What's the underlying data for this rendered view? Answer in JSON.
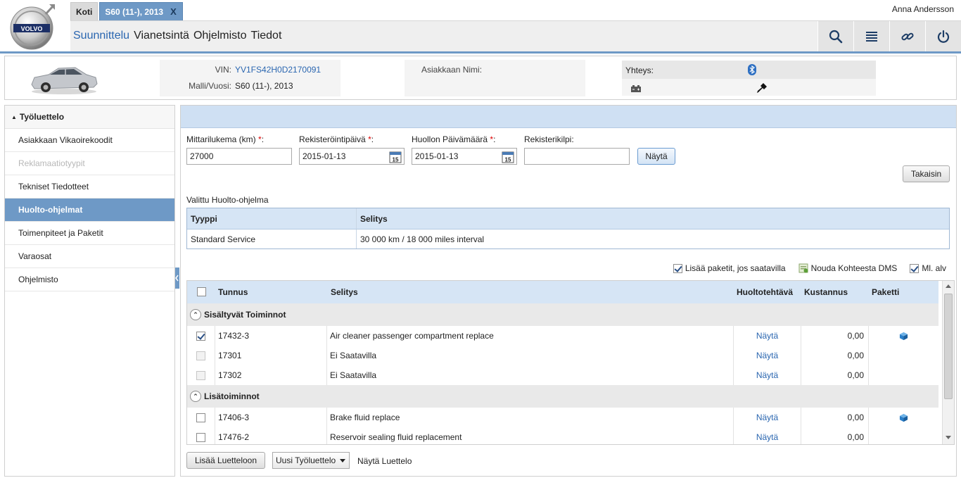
{
  "header": {
    "logo_text": "VOLVO",
    "tabs": [
      {
        "label": "Koti"
      },
      {
        "label": "S60 (11-), 2013",
        "close": "X"
      }
    ],
    "user": "Anna Andersson",
    "menu": [
      "Suunnittelu",
      "Vianetsintä",
      "Ohjelmisto",
      "Tiedot"
    ],
    "tool_icons": [
      "search-icon",
      "list-icon",
      "link-icon",
      "power-icon"
    ]
  },
  "vehicle": {
    "vin_label": "VIN:",
    "vin": "YV1FS42H0D2170091",
    "model_label": "Malli/Vuosi:",
    "model": "S60 (11-), 2013",
    "customer_label": "Asiakkaan Nimi:",
    "connection_label": "Yhteys:"
  },
  "sidebar": {
    "header": "Työluettelo",
    "items": [
      {
        "label": "Asiakkaan Vikaoirekoodit"
      },
      {
        "label": "Reklamaatiotyypit"
      },
      {
        "label": "Tekniset Tiedotteet"
      },
      {
        "label": "Huolto-ohjelmat"
      },
      {
        "label": "Toimenpiteet ja Paketit"
      },
      {
        "label": "Varaosat"
      },
      {
        "label": "Ohjelmisto"
      }
    ]
  },
  "form": {
    "mileage_label": "Mittarilukema (km)",
    "mileage_value": "27000",
    "reg_date_label": "Rekisteröintipäivä",
    "reg_date_value": "2015-01-13",
    "service_date_label": "Huollon Päivämäärä",
    "service_date_value": "2015-01-13",
    "plate_label": "Rekisterikilpi:",
    "plate_value": "",
    "required_mark": "*",
    "colon": ":",
    "show_button": "Näytä",
    "back_button": "Takaisin",
    "calendar_day": "15"
  },
  "selected_program": {
    "title": "Valittu Huolto-ohjelma",
    "col_type": "Tyyppi",
    "col_desc": "Selitys",
    "row_type": "Standard Service",
    "row_desc": "30 000 km / 18 000 miles interval"
  },
  "options": {
    "add_packages": "Lisää paketit, jos saatavilla",
    "fetch_dms": "Nouda Kohteesta  DMS",
    "incl_vat": "Ml. alv"
  },
  "grid": {
    "headers": {
      "code": "Tunnus",
      "desc": "Selitys",
      "task": "Huoltotehtävä",
      "cost": "Kustannus",
      "package": "Paketti"
    },
    "groups": [
      {
        "label": "Sisältyvät Toiminnot",
        "rows": [
          {
            "code": "17432-3",
            "desc": "Air cleaner passenger compartment replace",
            "task": "Näytä",
            "cost": "0,00"
          },
          {
            "code": "17301",
            "desc": "Ei Saatavilla",
            "task": "Näytä",
            "cost": "0,00"
          },
          {
            "code": "17302",
            "desc": "Ei Saatavilla",
            "task": "Näytä",
            "cost": "0,00"
          }
        ]
      },
      {
        "label": "Lisätoiminnot",
        "rows": [
          {
            "code": "17406-3",
            "desc": "Brake fluid replace",
            "task": "Näytä",
            "cost": "0,00"
          },
          {
            "code": "17476-2",
            "desc": "Reservoir sealing fluid replacement",
            "task": "Näytä",
            "cost": "0,00"
          }
        ]
      }
    ]
  },
  "footer": {
    "add_button": "Lisää Luetteloon",
    "list_select": "Uusi Työluettelo",
    "show_list": "Näytä Luettelo"
  },
  "colors": {
    "accent": "#6e99c6",
    "band": "#cfe0f3",
    "link": "#2a66b0"
  }
}
